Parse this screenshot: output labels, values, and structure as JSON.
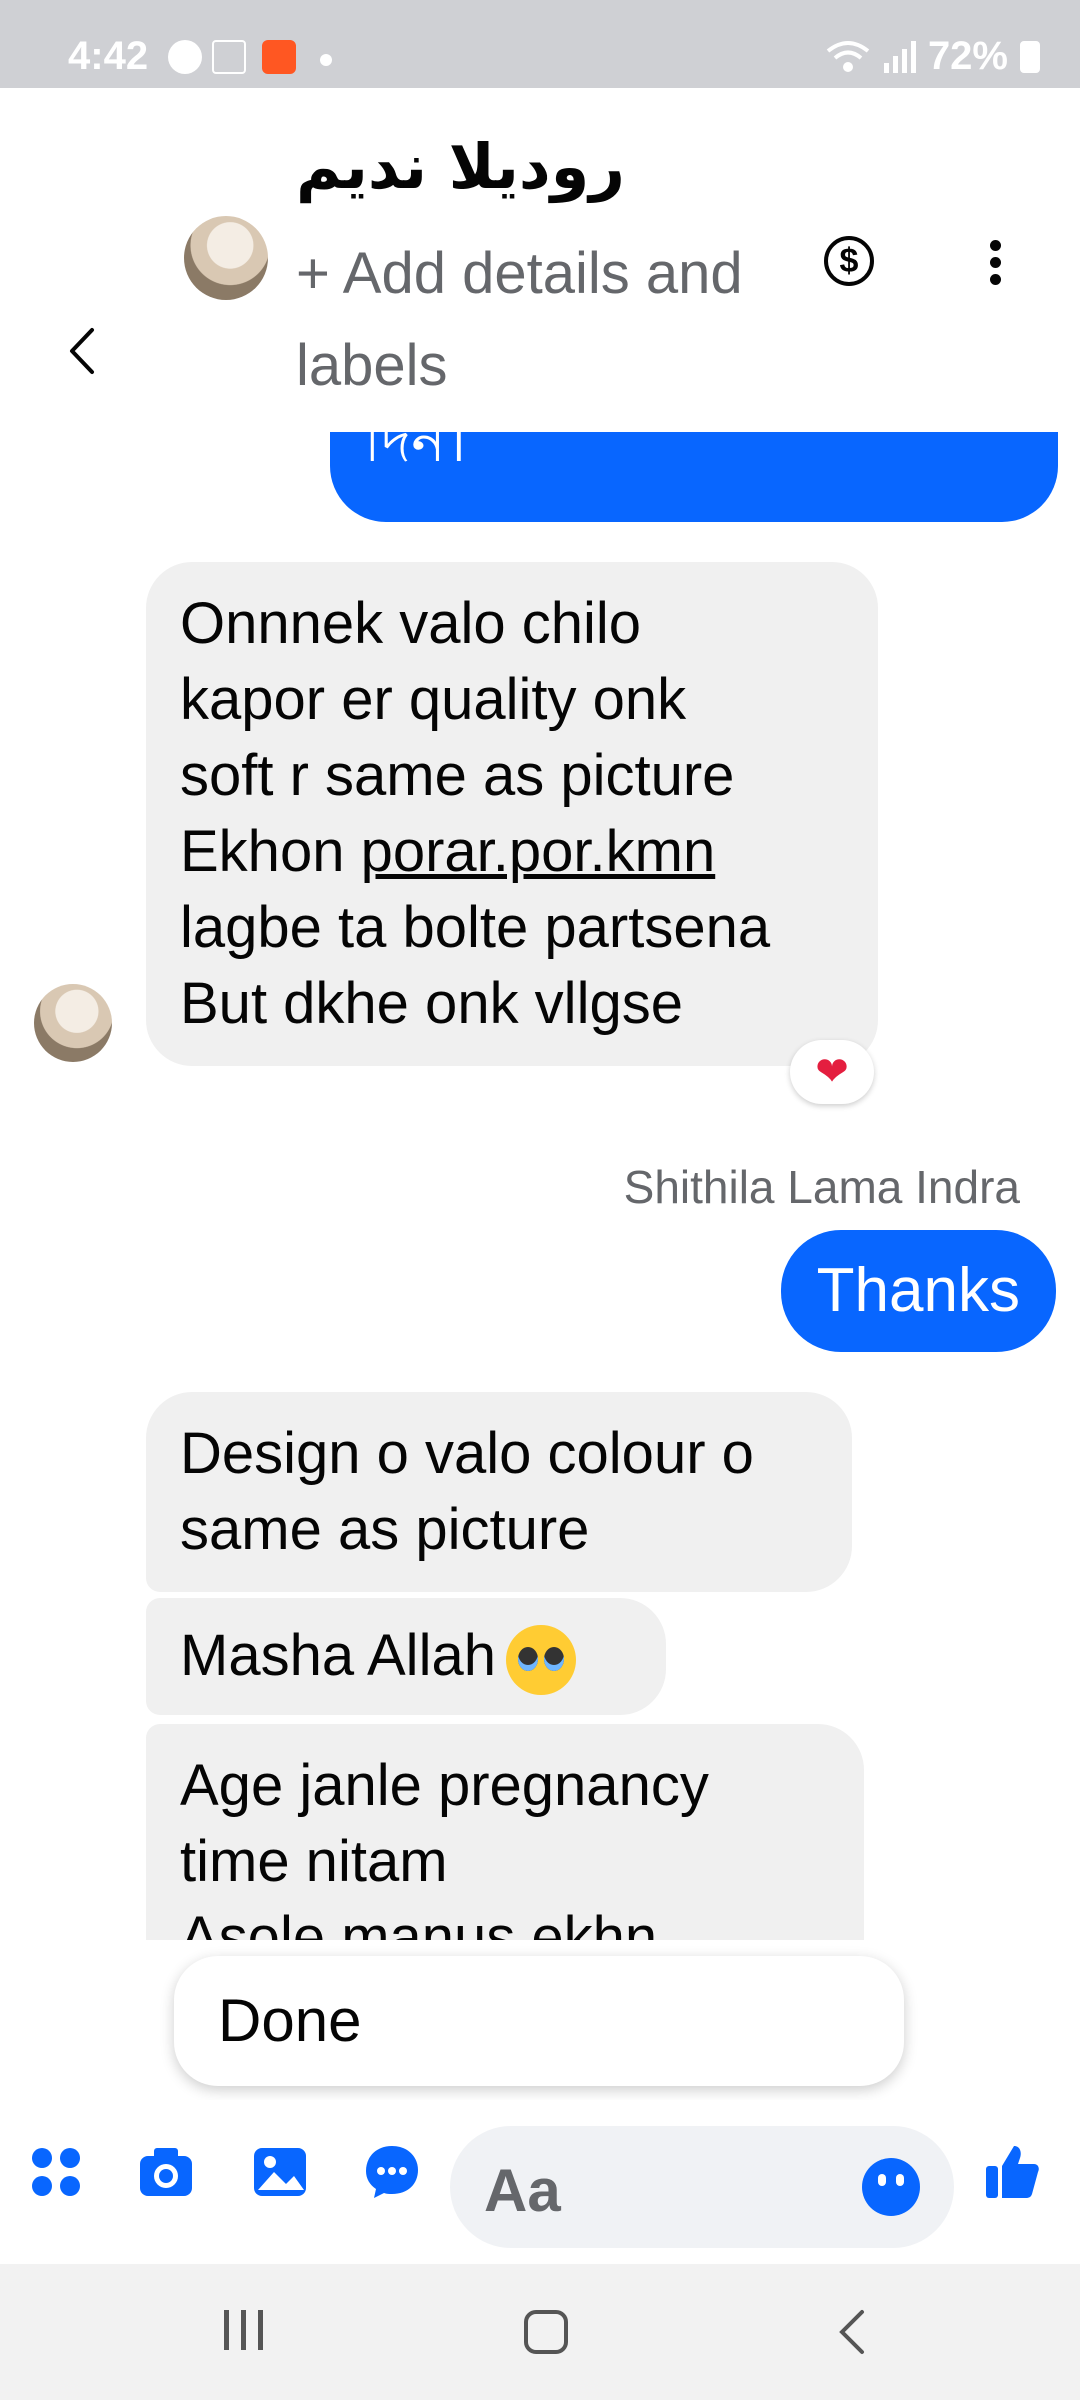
{
  "status_bar": {
    "time": "4:42",
    "battery": "72%"
  },
  "header": {
    "contact_name": "رودیلا ندیم",
    "add_details": "+ Add details and labels"
  },
  "messages": {
    "top_outgoing_partial": "দিন।",
    "msg1_line1": "Onnnek valo chilo",
    "msg1_line2": "kapor er quality onk",
    "msg1_line3": "soft r same as picture",
    "msg1_line4_prefix": "Ekhon ",
    "msg1_line4_link": "porar.por.kmn",
    "msg1_line5": "lagbe ta bolte partsena",
    "msg1_line6": "But dkhe onk vllgse",
    "reaction": "❤",
    "sender_name": "Shithila Lama Indra",
    "thanks": "Thanks",
    "msg2": "Design o valo colour o same as picture",
    "msg3": "Masha Allah",
    "msg4_line1": "Age janle pregnancy",
    "msg4_line2": "time nitam",
    "msg4_line3": "Asole manus ekhn"
  },
  "suggestion": {
    "done": "Done"
  },
  "composer": {
    "placeholder": "Aa"
  },
  "icons": [
    "messenger-icon",
    "home-icon",
    "app-icon",
    "wifi-icon",
    "signal-icon",
    "battery-icon",
    "back-icon",
    "dollar-icon",
    "more-icon",
    "heart-icon",
    "apps-icon",
    "camera-icon",
    "gallery-icon",
    "chat-icon",
    "emoji-icon",
    "like-icon",
    "recents-icon",
    "home-nav-icon",
    "back-nav-icon"
  ],
  "colors": {
    "accent": "#0866ff",
    "incoming_bubble": "#f0f0f0",
    "status_bar": "#cfd0d4"
  }
}
